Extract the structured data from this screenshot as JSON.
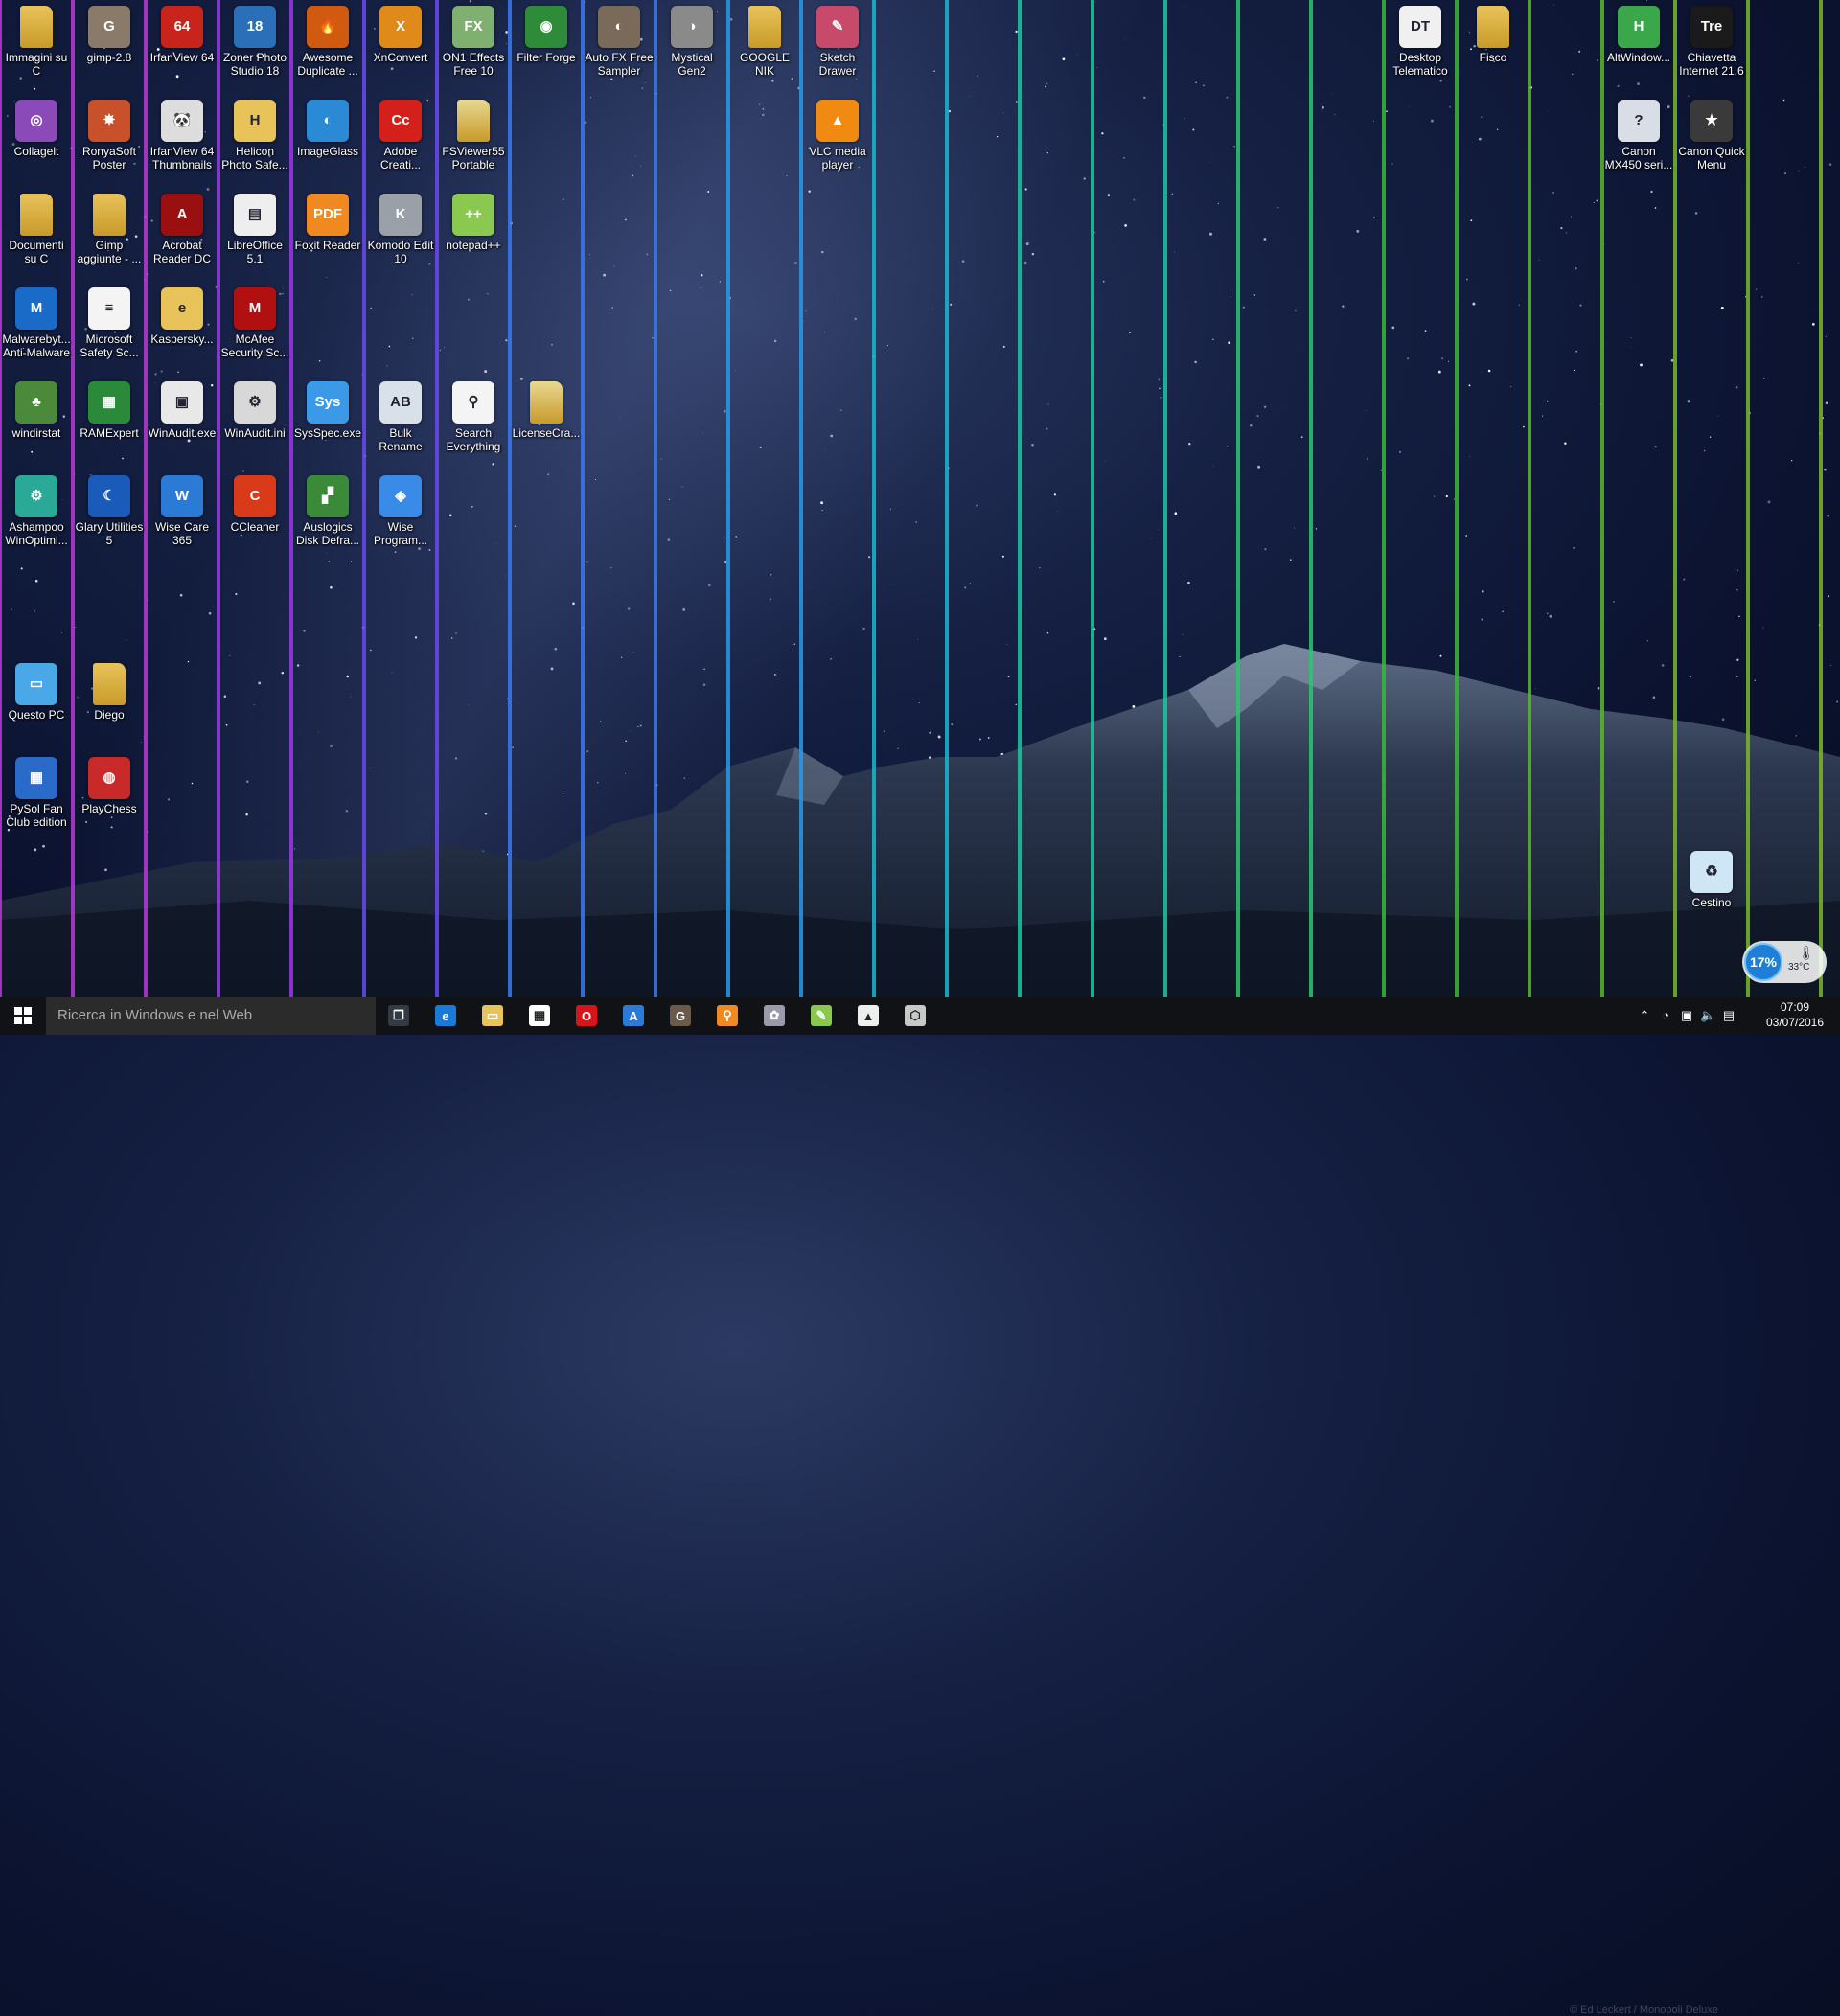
{
  "desktop": {
    "icons": [
      {
        "label": "Immagini su C",
        "icon": "folder-icon",
        "color": "#e8c35a",
        "glyph": ""
      },
      {
        "label": "gimp-2.8",
        "icon": "gimp-icon",
        "color": "#8a7a6a",
        "glyph": "G"
      },
      {
        "label": "IrfanView 64",
        "icon": "irfanview-icon",
        "color": "#c8241c",
        "glyph": "64"
      },
      {
        "label": "Zoner Photo Studio 18",
        "icon": "zoner-icon",
        "color": "#2b6fb8",
        "glyph": "18"
      },
      {
        "label": "Awesome Duplicate ...",
        "icon": "flame-icon",
        "color": "#d05a10",
        "glyph": "🔥"
      },
      {
        "label": "XnConvert",
        "icon": "xnconvert-icon",
        "color": "#e08a1a",
        "glyph": "X"
      },
      {
        "label": "ON1 Effects Free 10",
        "icon": "on1-icon",
        "color": "#7fb070",
        "glyph": "FX"
      },
      {
        "label": "Filter Forge",
        "icon": "filterforge-icon",
        "color": "#2e8b3a",
        "glyph": "◉"
      },
      {
        "label": "Auto FX Free Sampler",
        "icon": "autofx-icon",
        "color": "#7a6a5a",
        "glyph": "◐"
      },
      {
        "label": "Mystical Gen2",
        "icon": "mystical-icon",
        "color": "#8a8a8a",
        "glyph": "◑"
      },
      {
        "label": "GOOGLE NIK COLLECTION",
        "icon": "folder-icon",
        "color": "#e8c35a",
        "glyph": ""
      },
      {
        "label": "Sketch Drawer",
        "icon": "sketch-icon",
        "color": "#c84a6a",
        "glyph": "✎"
      },
      {
        "label": "Desktop Telematico",
        "icon": "dt-icon",
        "color": "#f0f0f0",
        "glyph": "DT"
      },
      {
        "label": "Fisco",
        "icon": "folder-icon",
        "color": "#e8c35a",
        "glyph": ""
      },
      {
        "label": "AltWindow...",
        "icon": "altwindow-icon",
        "color": "#3aa84a",
        "glyph": "H"
      },
      {
        "label": "Chiavetta Internet 21.6",
        "icon": "treit-icon",
        "color": "#1a1a1a",
        "glyph": "Tre"
      },
      {
        "label": "Collagelt",
        "icon": "collage-icon",
        "color": "#8a4ab8",
        "glyph": "◎"
      },
      {
        "label": "RonyaSoft Poster Print...",
        "icon": "butterfly-icon",
        "color": "#c8502a",
        "glyph": "✸"
      },
      {
        "label": "IrfanView 64 Thumbnails",
        "icon": "panda-icon",
        "color": "#dddddd",
        "glyph": "🐼"
      },
      {
        "label": "Helicon Photo Safe...",
        "icon": "helicon-icon",
        "color": "#e8c35a",
        "glyph": "H"
      },
      {
        "label": "ImageGlass",
        "icon": "imageglass-icon",
        "color": "#2a8ad6",
        "glyph": "◐"
      },
      {
        "label": "Adobe Creati...",
        "icon": "adobe-cc-icon",
        "color": "#d4201a",
        "glyph": "Cc"
      },
      {
        "label": "FSViewer55 Portable",
        "icon": "folder-icon",
        "color": "#e8d890",
        "glyph": ""
      },
      {
        "label": "VLC media player",
        "icon": "vlc-icon",
        "color": "#f08a10",
        "glyph": "▲"
      },
      {
        "label": "Canon MX450 seri...",
        "icon": "canon-printer-icon",
        "color": "#d8dde6",
        "glyph": "?"
      },
      {
        "label": "Canon Quick Menu",
        "icon": "canon-quick-icon",
        "color": "#3a3a3a",
        "glyph": "★"
      },
      {
        "label": "Documenti su C",
        "icon": "folder-icon",
        "color": "#e8c35a",
        "glyph": ""
      },
      {
        "label": "Gimp aggiunte - ...",
        "icon": "folder-icon",
        "color": "#e8c35a",
        "glyph": ""
      },
      {
        "label": "Acrobat Reader DC",
        "icon": "acrobat-icon",
        "color": "#9a1010",
        "glyph": "A"
      },
      {
        "label": "LibreOffice 5.1",
        "icon": "libreoffice-icon",
        "color": "#eeeeee",
        "glyph": "▤"
      },
      {
        "label": "Foxit Reader",
        "icon": "foxit-icon",
        "color": "#f08a20",
        "glyph": "PDF"
      },
      {
        "label": "Komodo Edit 10",
        "icon": "komodo-icon",
        "color": "#9aa0a8",
        "glyph": "K"
      },
      {
        "label": "notepad++",
        "icon": "notepadpp-icon",
        "color": "#8ac850",
        "glyph": "++"
      },
      {
        "label": "Malwarebyt... Anti-Malware",
        "icon": "malwarebytes-icon",
        "color": "#1a6ac8",
        "glyph": "M"
      },
      {
        "label": "Microsoft Safety Sc...",
        "icon": "document-icon",
        "color": "#f4f4f4",
        "glyph": "≡"
      },
      {
        "label": "Kaspersky...",
        "icon": "kaspersky-icon",
        "color": "#e8c35a",
        "glyph": "e"
      },
      {
        "label": "McAfee Security Sc...",
        "icon": "mcafee-icon",
        "color": "#b01010",
        "glyph": "M"
      },
      {
        "label": "windirstat",
        "icon": "tree-icon",
        "color": "#4a8a3a",
        "glyph": "♣"
      },
      {
        "label": "RAMExpert",
        "icon": "ram-icon",
        "color": "#2a8a3a",
        "glyph": "▦"
      },
      {
        "label": "WinAudit.exe",
        "icon": "winaudit-icon",
        "color": "#e8e8e8",
        "glyph": "▣"
      },
      {
        "label": "WinAudit.ini",
        "icon": "ini-file-icon",
        "color": "#d8d8d8",
        "glyph": "⚙"
      },
      {
        "label": "SysSpec.exe",
        "icon": "sysspec-icon",
        "color": "#3a9ae8",
        "glyph": "Sys"
      },
      {
        "label": "Bulk Rename Utility",
        "icon": "bulkrename-icon",
        "color": "#d8e0ea",
        "glyph": "AB"
      },
      {
        "label": "Search Everything",
        "icon": "everything-icon",
        "color": "#f4f4f4",
        "glyph": "⚲"
      },
      {
        "label": "LicenseCra...",
        "icon": "folder-icon",
        "color": "#e8d890",
        "glyph": ""
      },
      {
        "label": "Ashampoo WinOptimi...",
        "icon": "ashampoo-icon",
        "color": "#2aa898",
        "glyph": "⚙"
      },
      {
        "label": "Glary Utilities 5",
        "icon": "glary-icon",
        "color": "#1a5ab8",
        "glyph": "☾"
      },
      {
        "label": "Wise Care 365",
        "icon": "wisecare-icon",
        "color": "#2a7ad6",
        "glyph": "W"
      },
      {
        "label": "CCleaner",
        "icon": "ccleaner-icon",
        "color": "#d83a1a",
        "glyph": "C"
      },
      {
        "label": "Auslogics Disk Defra...",
        "icon": "auslogics-icon",
        "color": "#3a8a3a",
        "glyph": "▞"
      },
      {
        "label": "Wise Program...",
        "icon": "wiseprogram-icon",
        "color": "#3a8ae8",
        "glyph": "◈"
      },
      {
        "label": "Questo PC",
        "icon": "computer-icon",
        "color": "#4aa8e8",
        "glyph": "▭"
      },
      {
        "label": "Diego",
        "icon": "folder-icon",
        "color": "#e8c35a",
        "glyph": ""
      },
      {
        "label": "PySol Fan Club edition",
        "icon": "pysol-icon",
        "color": "#2a6ac8",
        "glyph": "▦"
      },
      {
        "label": "PlayChess",
        "icon": "playchess-icon",
        "color": "#c82a2a",
        "glyph": "◍"
      },
      {
        "label": "Cestino",
        "icon": "recycle-bin-icon",
        "color": "#cfe6f6",
        "glyph": "♻"
      }
    ]
  },
  "widget": {
    "percent": "17%",
    "temp": "33°C"
  },
  "taskbar": {
    "search_placeholder": "Ricerca in Windows e nel Web",
    "apps": [
      {
        "name": "task-view-icon",
        "color": "#333a44",
        "glyph": "❐"
      },
      {
        "name": "edge-icon",
        "color": "#1a7ad8",
        "glyph": "e"
      },
      {
        "name": "file-explorer-icon",
        "color": "#e8c35a",
        "glyph": "▭"
      },
      {
        "name": "store-icon",
        "color": "#ffffff",
        "glyph": "▦"
      },
      {
        "name": "opera-icon",
        "color": "#d8141a",
        "glyph": "O"
      },
      {
        "name": "app-a-icon",
        "color": "#2a7ad8",
        "glyph": "A"
      },
      {
        "name": "gimp-taskbar-icon",
        "color": "#6a5a4a",
        "glyph": "G"
      },
      {
        "name": "search-everything-taskbar-icon",
        "color": "#f08a20",
        "glyph": "⚲"
      },
      {
        "name": "paint-taskbar-icon",
        "color": "#9a9aa8",
        "glyph": "✿"
      },
      {
        "name": "notepadpp-taskbar-icon",
        "color": "#8ac850",
        "glyph": "✎"
      },
      {
        "name": "photos-taskbar-icon",
        "color": "#eeeeee",
        "glyph": "▲"
      },
      {
        "name": "hexagon-app-icon",
        "color": "#c8c8c8",
        "glyph": "⬡"
      }
    ],
    "clock_time": "07:09",
    "clock_date": "03/07/2016",
    "watermark": "© Ed Leckert / Monopoli Deluxe"
  }
}
